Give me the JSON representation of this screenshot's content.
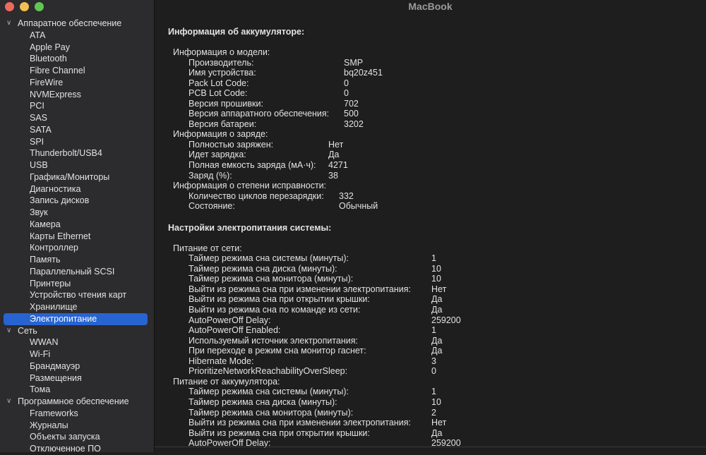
{
  "window": {
    "title": "MacBook"
  },
  "sidebar": {
    "sections": [
      {
        "label": "Аппаратное обеспечение",
        "items": [
          "ATA",
          "Apple Pay",
          "Bluetooth",
          "Fibre Channel",
          "FireWire",
          "NVMExpress",
          "PCI",
          "SAS",
          "SATA",
          "SPI",
          "Thunderbolt/USB4",
          "USB",
          "Графика/Мониторы",
          "Диагностика",
          "Запись дисков",
          "Звук",
          "Камера",
          "Карты Ethernet",
          "Контроллер",
          "Память",
          "Параллельный SCSI",
          "Принтеры",
          "Устройство чтения карт",
          "Хранилище",
          "Электропитание"
        ]
      },
      {
        "label": "Сеть",
        "items": [
          "WWAN",
          "Wi-Fi",
          "Брандмауэр",
          "Размещения",
          "Тома"
        ]
      },
      {
        "label": "Программное обеспечение",
        "items": [
          "Frameworks",
          "Журналы",
          "Объекты запуска",
          "Отключенное ПО"
        ]
      }
    ],
    "selected": "Электропитание"
  },
  "battery": {
    "title": "Информация об аккумуляторе:",
    "groups": [
      {
        "label": "Информация о модели:",
        "col": 220,
        "rows": [
          [
            "Производитель:",
            "SMP"
          ],
          [
            "Имя устройства:",
            "bq20z451"
          ],
          [
            "Pack Lot Code:",
            "0"
          ],
          [
            "PCB Lot Code:",
            "0"
          ],
          [
            "Версия прошивки:",
            "702"
          ],
          [
            "Версия аппаратного обеспечения:",
            "500"
          ],
          [
            "Версия батареи:",
            "3202"
          ]
        ]
      },
      {
        "label": "Информация о заряде:",
        "col": 198,
        "rows": [
          [
            "Полностью заряжен:",
            "Нет"
          ],
          [
            "Идет зарядка:",
            "Да"
          ],
          [
            "Полная емкость заряда (мА·ч):",
            "4271"
          ],
          [
            "Заряд (%):",
            "38"
          ]
        ]
      },
      {
        "label": "Информация о степени исправности:",
        "col": 213,
        "rows": [
          [
            "Количество циклов перезарядки:",
            "332"
          ],
          [
            "Состояние:",
            "Обычный"
          ]
        ]
      }
    ]
  },
  "power": {
    "title": "Настройки электропитания системы:",
    "groups": [
      {
        "label": "Питание от сети:",
        "col": 344,
        "rows": [
          [
            "Таймер режима сна системы (минуты):",
            "1"
          ],
          [
            "Таймер режима сна диска (минуты):",
            "10"
          ],
          [
            "Таймер режима сна монитора (минуты):",
            "10"
          ],
          [
            "Выйти из режима сна при изменении электропитания:",
            "Нет"
          ],
          [
            "Выйти из режима сна при открытии крышки:",
            "Да"
          ],
          [
            "Выйти из режима сна по команде из сети:",
            "Да"
          ],
          [
            "AutoPowerOff Delay:",
            "259200"
          ],
          [
            "AutoPowerOff Enabled:",
            "1"
          ],
          [
            "Используемый источник электропитания:",
            "Да"
          ],
          [
            "При переходе в режим сна монитор гаснет:",
            "Да"
          ],
          [
            "Hibernate Mode:",
            "3"
          ],
          [
            "PrioritizeNetworkReachabilityOverSleep:",
            "0"
          ]
        ]
      },
      {
        "label": "Питание от аккумулятора:",
        "col": 344,
        "rows": [
          [
            "Таймер режима сна системы (минуты):",
            "1"
          ],
          [
            "Таймер режима сна диска (минуты):",
            "10"
          ],
          [
            "Таймер режима сна монитора (минуты):",
            "2"
          ],
          [
            "Выйти из режима сна при изменении электропитания:",
            "Нет"
          ],
          [
            "Выйти из режима сна при открытии крышки:",
            "Да"
          ],
          [
            "AutoPowerOff Delay:",
            "259200"
          ]
        ]
      }
    ]
  },
  "colors": {
    "accent": "#2764d1",
    "close": "#ed6a5e",
    "minimize": "#f5bf4f",
    "zoom": "#61c554"
  }
}
